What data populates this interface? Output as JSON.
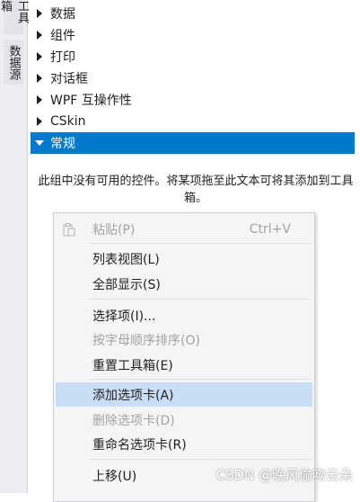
{
  "side_tabs": [
    "工具箱",
    "数据源"
  ],
  "toolbox": {
    "groups": [
      {
        "label": "数据",
        "expanded": false
      },
      {
        "label": "组件",
        "expanded": false
      },
      {
        "label": "打印",
        "expanded": false
      },
      {
        "label": "对话框",
        "expanded": false
      },
      {
        "label": "WPF 互操作性",
        "expanded": false
      },
      {
        "label": "CSkin",
        "expanded": false
      },
      {
        "label": "常规",
        "expanded": true
      }
    ],
    "empty_message": "此组中没有可用的控件。将某项拖至此文本可将其添加到工具箱。"
  },
  "context_menu": {
    "items": [
      {
        "label": "粘贴(P)",
        "shortcut": "Ctrl+V",
        "enabled": false
      },
      {
        "label": "列表视图(L)",
        "enabled": true
      },
      {
        "label": "全部显示(S)",
        "enabled": true
      },
      {
        "label": "选择项(I)...",
        "enabled": true
      },
      {
        "label": "按字母顺序排序(O)",
        "enabled": false
      },
      {
        "label": "重置工具箱(E)",
        "enabled": true
      },
      {
        "label": "添加选项卡(A)",
        "enabled": true,
        "hovered": true
      },
      {
        "label": "删除选项卡(D)",
        "enabled": false
      },
      {
        "label": "重命名选项卡(R)",
        "enabled": true
      },
      {
        "label": "上移(U)",
        "enabled": true
      }
    ]
  },
  "watermark": "CSDN @晚风偷吻云朵",
  "colors": {
    "selection": "#007acc",
    "menu_hover": "#c9def5",
    "disabled_text": "#a2a2a2"
  }
}
